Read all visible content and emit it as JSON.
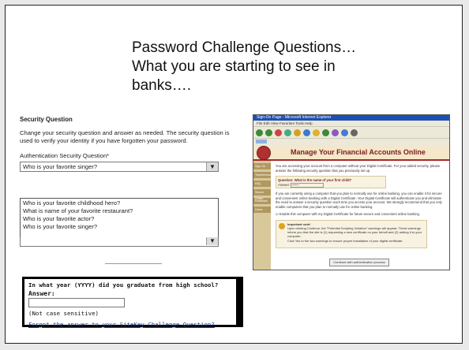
{
  "slide": {
    "title_lines": [
      "Password Challenge Questions…",
      "What you are starting to see in",
      "banks…."
    ]
  },
  "security_panel": {
    "heading": "Security Question",
    "description": "Change your security question and answer as needed. The security question is used to verify your identity if you have forgotten your password.",
    "field_label": "Authentication Security Question*",
    "selected_value": "Who is your favorite singer?",
    "options": [
      "Who is your favorite childhood hero?",
      "What is name of your favorite restaurant?",
      "Who is your favorite actor?",
      "Who is your favorite singer?"
    ]
  },
  "sitekey": {
    "question": "In what year (YYYY) did you graduate from high school?",
    "answer_label": "Answer:",
    "note": "(Not case sensitive)",
    "forgot_link": "Forgot the answer to your SiteKey Challenge Question?"
  },
  "browser": {
    "window_title": "Sign-On Page - Microsoft Internet Explorer",
    "menu": "File  Edit  View  Favorites  Tools  Help",
    "headline": "Manage Your Financial Accounts Online",
    "sidebar_items": [
      "Sign On",
      "Troubleshooting",
      "FAQ",
      "Secure Online",
      "Feedback",
      "Home"
    ],
    "intro": "You are accessing your account from a computer without your Digital Certificate. For your added security, please answer the following security question that you previously set up.",
    "question": "Question: What is the name of your first child?",
    "answer_label": "Answer:",
    "answer_value": "********",
    "body": "If you are currently using a computer that you plan to normally use for online banking, you can enable it for secure and convenient online banking with a Digital Certificate. Your Digital Certificate will authenticate you and eliminate the need to answer a security question each time you access your account. We strongly recommend that you only enable computers that you plan to normally use for online banking.",
    "checkbox_label": "Enable this computer with my Digital Certificate for future secure and convenient online banking.",
    "note_title": "Important note!",
    "note_text": "Upon clicking Continue, the \"Potential Scripting Violation\" warnings will appear. These warnings inform you that the site is (1) requesting a new certificate on your behalf and (2) adding it to your computer.",
    "note_text2": "Click Yes to the two warnings to ensure proper installation of your digital certificate.",
    "continue_button": "Continue with authentication process"
  }
}
